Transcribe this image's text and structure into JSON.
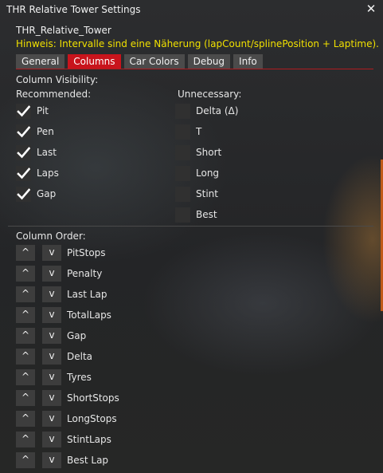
{
  "window": {
    "title": "THR Relative Tower Settings"
  },
  "app": {
    "name": "THR_Relative_Tower",
    "hint": "Hinweis: Intervalle sind eine Näherung (lapCount/splinePosition + Laptime)."
  },
  "tabs": [
    {
      "label": "General",
      "active": false
    },
    {
      "label": "Columns",
      "active": true
    },
    {
      "label": "Car Colors",
      "active": false
    },
    {
      "label": "Debug",
      "active": false
    },
    {
      "label": "Info",
      "active": false
    }
  ],
  "visibility": {
    "title": "Column Visibility:",
    "recommended_title": "Recommended:",
    "unnecessary_title": "Unnecessary:",
    "recommended": [
      {
        "label": "Pit",
        "checked": true
      },
      {
        "label": "Pen",
        "checked": true
      },
      {
        "label": "Last",
        "checked": true
      },
      {
        "label": "Laps",
        "checked": true
      },
      {
        "label": "Gap",
        "checked": true
      }
    ],
    "unnecessary": [
      {
        "label": "Delta (Δ)",
        "checked": false
      },
      {
        "label": "T",
        "checked": false
      },
      {
        "label": "Short",
        "checked": false
      },
      {
        "label": "Long",
        "checked": false
      },
      {
        "label": "Stint",
        "checked": false
      },
      {
        "label": "Best",
        "checked": false
      }
    ]
  },
  "order": {
    "title": "Column Order:",
    "up_label": "^",
    "down_label": "v",
    "items": [
      "PitStops",
      "Penalty",
      "Last Lap",
      "TotalLaps",
      "Gap",
      "Delta",
      "Tyres",
      "ShortStops",
      "LongStops",
      "StintLaps",
      "Best Lap"
    ]
  },
  "colors": {
    "accent": "#c8141c",
    "hint": "#f0e000"
  },
  "icons": {
    "close": "close-icon",
    "check": "checkmark-icon"
  }
}
